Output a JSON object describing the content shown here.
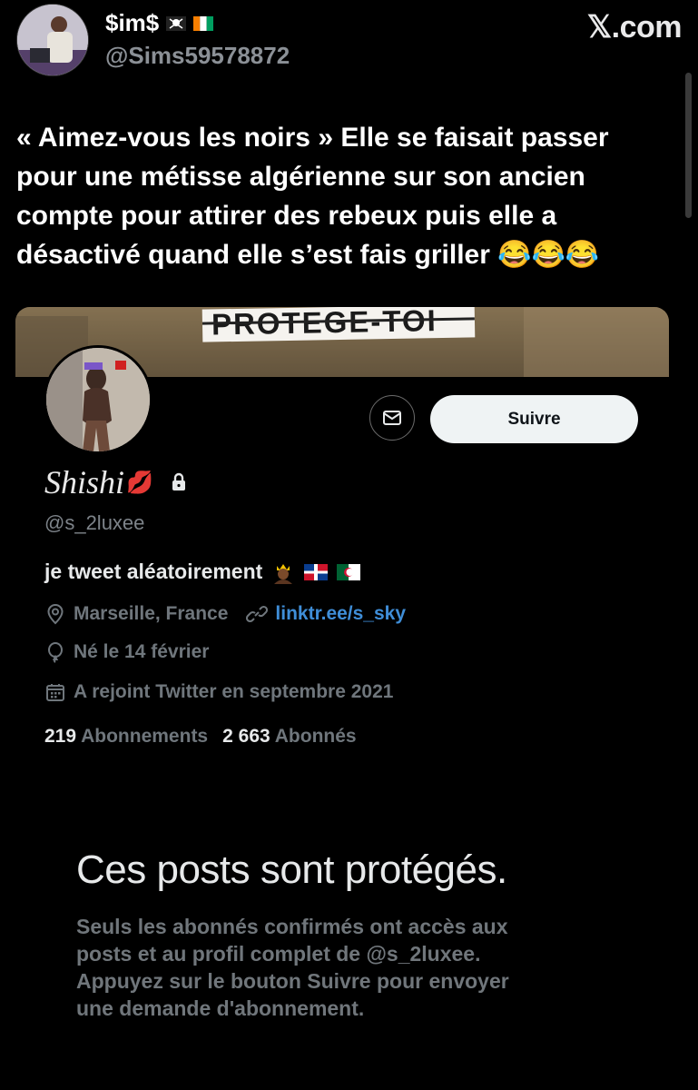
{
  "tweet": {
    "author_name": "$im$",
    "author_handle": "@Sims59578872",
    "brand": "𝕏.com",
    "text": "« Aimez-vous les noirs » Elle se faisait passer\npour une métisse algérienne sur son ancien\ncompte pour attirer des rebeux puis elle a\ndésactivé quand elle s’est fais griller 😂😂😂"
  },
  "profile": {
    "banner_text": "PROTEGE-TOI",
    "follow_label": "Suivre",
    "name": "Shishi",
    "name_emoji": "💋",
    "handle": "@s_2luxee",
    "bio": "je tweet aléatoirement",
    "location": "Marseille, France",
    "link": "linktr.ee/s_sky",
    "birthday": "Né le 14 février",
    "joined": "A rejoint Twitter en septembre 2021",
    "following_count": "219",
    "following_label": "Abonnements",
    "followers_count": "2 663",
    "followers_label": "Abonnés"
  },
  "protected": {
    "title": "Ces posts sont protégés.",
    "description": "Seuls les abonnés confirmés ont accès aux\nposts et au profil complet de @s_2luxee.\nAppuyez sur le bouton Suivre pour envoyer\nune demande d'abonnement."
  },
  "colors": {
    "background": "#000000",
    "muted": "#6f767c",
    "link": "#3f8ed8",
    "button_bg": "#eff3f4"
  }
}
